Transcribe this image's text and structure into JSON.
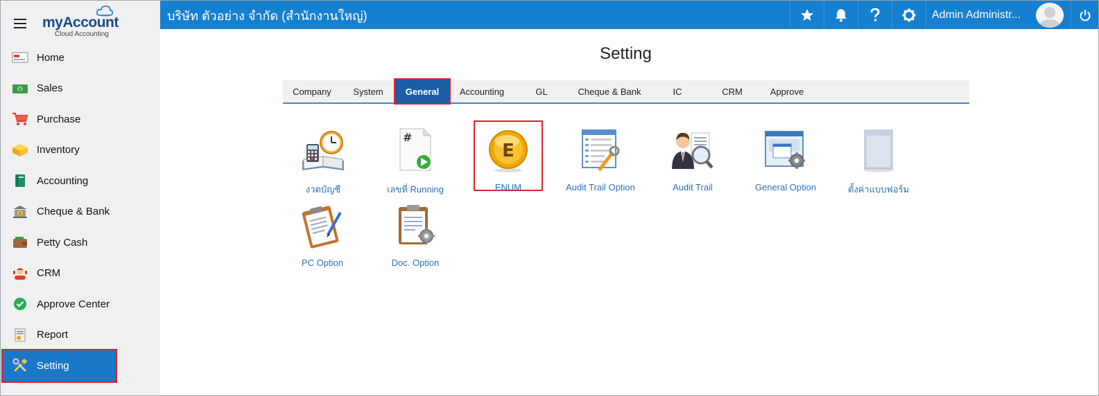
{
  "app": {
    "logo_text_my": "my",
    "logo_text_account": "Account",
    "logo_sub": "Cloud Accounting",
    "company": "บริษัท ตัวอย่าง จำกัด (สำนักงานใหญ่)",
    "user_name": "Admin Administr..."
  },
  "sidebar": {
    "items": [
      {
        "label": "Home",
        "icon": "home-icon"
      },
      {
        "label": "Sales",
        "icon": "sales-icon"
      },
      {
        "label": "Purchase",
        "icon": "cart-icon"
      },
      {
        "label": "Inventory",
        "icon": "box-icon"
      },
      {
        "label": "Accounting",
        "icon": "book-icon"
      },
      {
        "label": "Cheque & Bank",
        "icon": "bank-icon"
      },
      {
        "label": "Petty Cash",
        "icon": "wallet-icon"
      },
      {
        "label": "CRM",
        "icon": "crm-icon"
      },
      {
        "label": "Approve Center",
        "icon": "check-icon"
      },
      {
        "label": "Report",
        "icon": "report-icon"
      },
      {
        "label": "Setting",
        "icon": "tools-icon",
        "active": true
      }
    ]
  },
  "page": {
    "title": "Setting",
    "tabs": [
      {
        "label": "Company"
      },
      {
        "label": "System"
      },
      {
        "label": "General",
        "active": true
      },
      {
        "label": "Accounting"
      },
      {
        "label": "GL"
      },
      {
        "label": "Cheque & Bank"
      },
      {
        "label": "IC"
      },
      {
        "label": "CRM"
      },
      {
        "label": "Approve"
      }
    ],
    "tiles": [
      {
        "label": "งวดบัญชี",
        "icon": "period-book-icon"
      },
      {
        "label": "เลขที่ Running",
        "icon": "running-number-icon"
      },
      {
        "label": "ENUM",
        "icon": "enum-coin-icon",
        "highlighted": true
      },
      {
        "label": "Audit Trail Option",
        "icon": "audit-option-icon"
      },
      {
        "label": "Audit Trail",
        "icon": "audit-trail-icon"
      },
      {
        "label": "General Option",
        "icon": "general-option-icon"
      },
      {
        "label": "ตั้งค่าแบบฟอร์ม",
        "icon": "form-setup-icon"
      },
      {
        "label": "PC Option",
        "icon": "pc-option-icon"
      },
      {
        "label": "Doc. Option",
        "icon": "doc-option-icon"
      }
    ]
  },
  "colors": {
    "topbar": "#1680d0",
    "active_nav": "#1a78c8",
    "active_tab": "#1a5fa8",
    "highlight_border": "#e0222a",
    "tile_caption": "#2a6fb8"
  }
}
